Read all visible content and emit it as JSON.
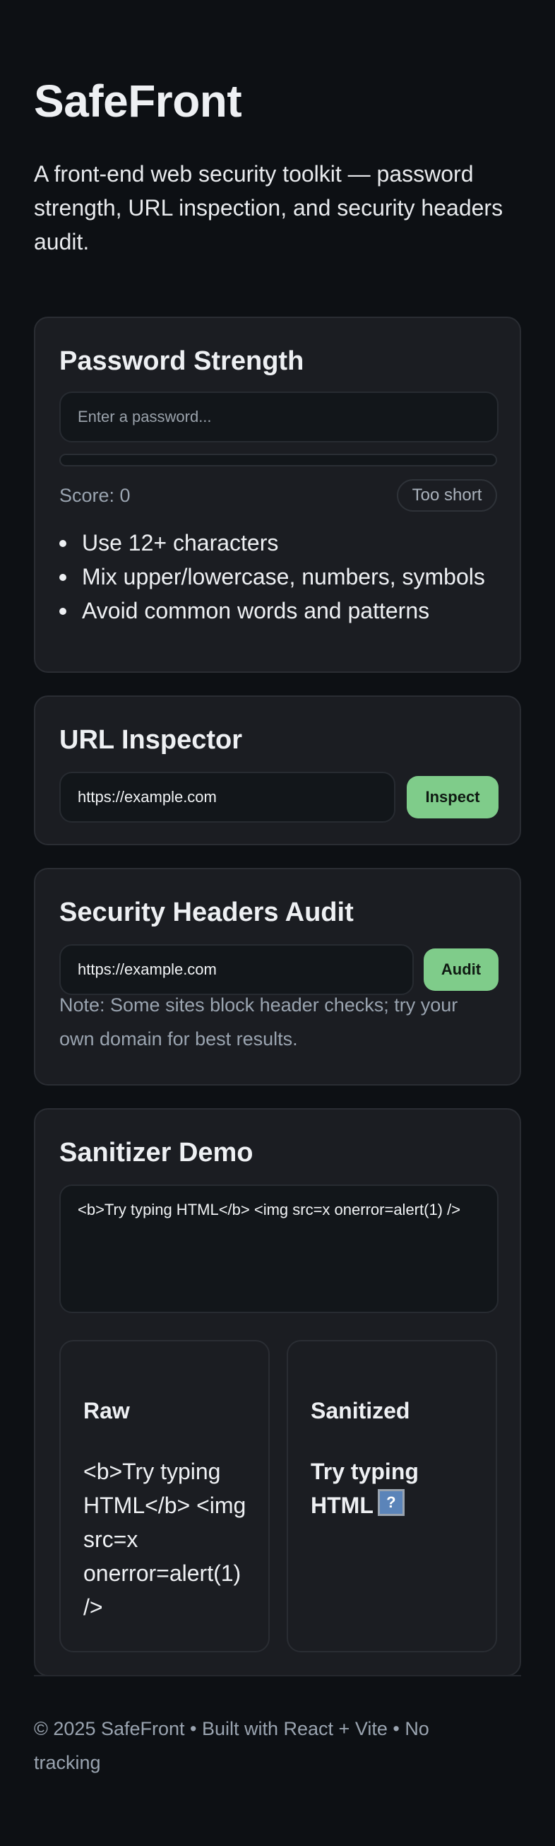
{
  "app": {
    "title": "SafeFront",
    "subtitle": "A front-end web security toolkit — password strength, URL inspection, and security headers audit."
  },
  "password": {
    "heading": "Password Strength",
    "placeholder": "Enter a password...",
    "strength_fraction": 0,
    "score_label": "Score: 0",
    "strength_badge": "Too short",
    "tips": [
      "Use 12+ characters",
      "Mix upper/lowercase, numbers, symbols",
      "Avoid common words and patterns"
    ]
  },
  "url_inspector": {
    "heading": "URL Inspector",
    "url_value": "https://example.com",
    "button_label": "Inspect"
  },
  "headers_audit": {
    "heading": "Security Headers Audit",
    "url_value": "https://example.com",
    "button_label": "Audit",
    "note": "Note: Some sites block header checks; try your own domain for best results."
  },
  "sanitizer": {
    "heading": "Sanitizer Demo",
    "input_value": "<b>Try typing HTML</b> <img src=x onerror=alert(1) />",
    "raw_heading": "Raw",
    "raw_output": "<b>Try typing HTML</b> <img src=x onerror=alert(1) />",
    "sanitized_heading": "Sanitized",
    "sanitized_text": "Try typing HTML",
    "sanitized_icon": "broken-image-icon"
  },
  "footer": {
    "text": "© 2025 SafeFront • Built with React + Vite • No tracking"
  },
  "colors": {
    "background": "#0d1014",
    "card": "#1b1d22",
    "accent": "#7fcc8a",
    "muted_text": "#9aa4b0"
  }
}
